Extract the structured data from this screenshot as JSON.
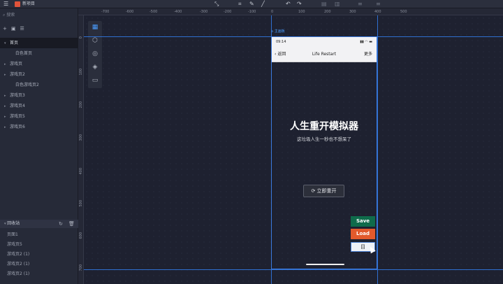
{
  "app": {
    "title": "新项目"
  },
  "toolbar": {
    "icons": [
      "menu-icon",
      "undo-icon",
      "redo-icon",
      "pen-icon",
      "align-icon"
    ]
  },
  "sidebar": {
    "search_placeholder": "搜索",
    "tree": [
      {
        "label": "首页",
        "level": 0,
        "selected": true
      },
      {
        "label": "白色首页",
        "level": 1
      },
      {
        "label": "游戏页",
        "level": 0
      },
      {
        "label": "游戏页2",
        "level": 0
      },
      {
        "label": "白色游戏页2",
        "level": 1
      },
      {
        "label": "游戏页3",
        "level": 0
      },
      {
        "label": "游戏页4",
        "level": 0
      },
      {
        "label": "游戏页5",
        "level": 0
      },
      {
        "label": "游戏页6",
        "level": 0
      }
    ],
    "recycle_title": "回收站",
    "recycle_items": [
      "页面1",
      "游戏页5",
      "游戏页2 (1)",
      "游戏页2 (1)",
      "游戏页2 (1)"
    ]
  },
  "ruler": {
    "h": [
      "-700",
      "-600",
      "-500",
      "-400",
      "-300",
      "-200",
      "-100",
      "0",
      "100",
      "200",
      "300",
      "400",
      "500"
    ],
    "v": [
      "0",
      "100",
      "200",
      "300",
      "400",
      "500",
      "600",
      "700"
    ]
  },
  "page_tag": "主画板",
  "phone": {
    "time": "09:14",
    "nav_back": "返回",
    "nav_title": "Life Restart",
    "nav_more": "更多",
    "headline": "人生重开模拟器",
    "subline": "这垃圾人生一秒也不想呆了",
    "restart_label": "立即重开",
    "save_label": "Save",
    "load_label": "Load",
    "third_label": "目"
  }
}
